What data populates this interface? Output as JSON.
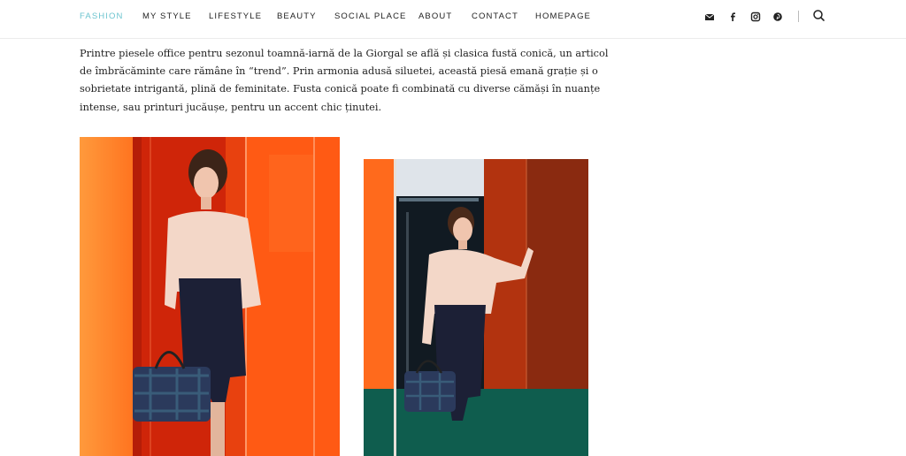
{
  "nav": {
    "items": [
      "FASHION",
      "MY STYLE",
      "LIFESTYLE",
      "BEAUTY",
      "SOCIAL PLACE",
      "ABOUT",
      "CONTACT",
      "HOMEPAGE"
    ],
    "active_index": 0,
    "social_icons": [
      "email-icon",
      "facebook-icon",
      "instagram-icon",
      "pinterest-icon"
    ],
    "search_icon": "search-icon"
  },
  "article": {
    "paragraph": "Printre piesele office pentru sezonul toamnă-iarnă de la Giorgal se află și clasica fustă conică, un articol de îmbrăcăminte care rămâne în “trend”. Prin armonia adusă siluetei, această piesă emană grație și o sobrietate intrigantă, plină de feminitate. Fusta conică poate fi combinată cu diverse cămăși în nuanțe intense, sau printuri jucăușe, pentru un accent chic ținutei."
  },
  "colors": {
    "accent": "#6cc4cf",
    "text": "#222222",
    "photo_orange": "#ff5a14",
    "photo_red": "#d92a0c",
    "skirt_navy": "#1c2036",
    "blouse": "#f3d7c8",
    "floor_teal": "#0f5d4e"
  }
}
